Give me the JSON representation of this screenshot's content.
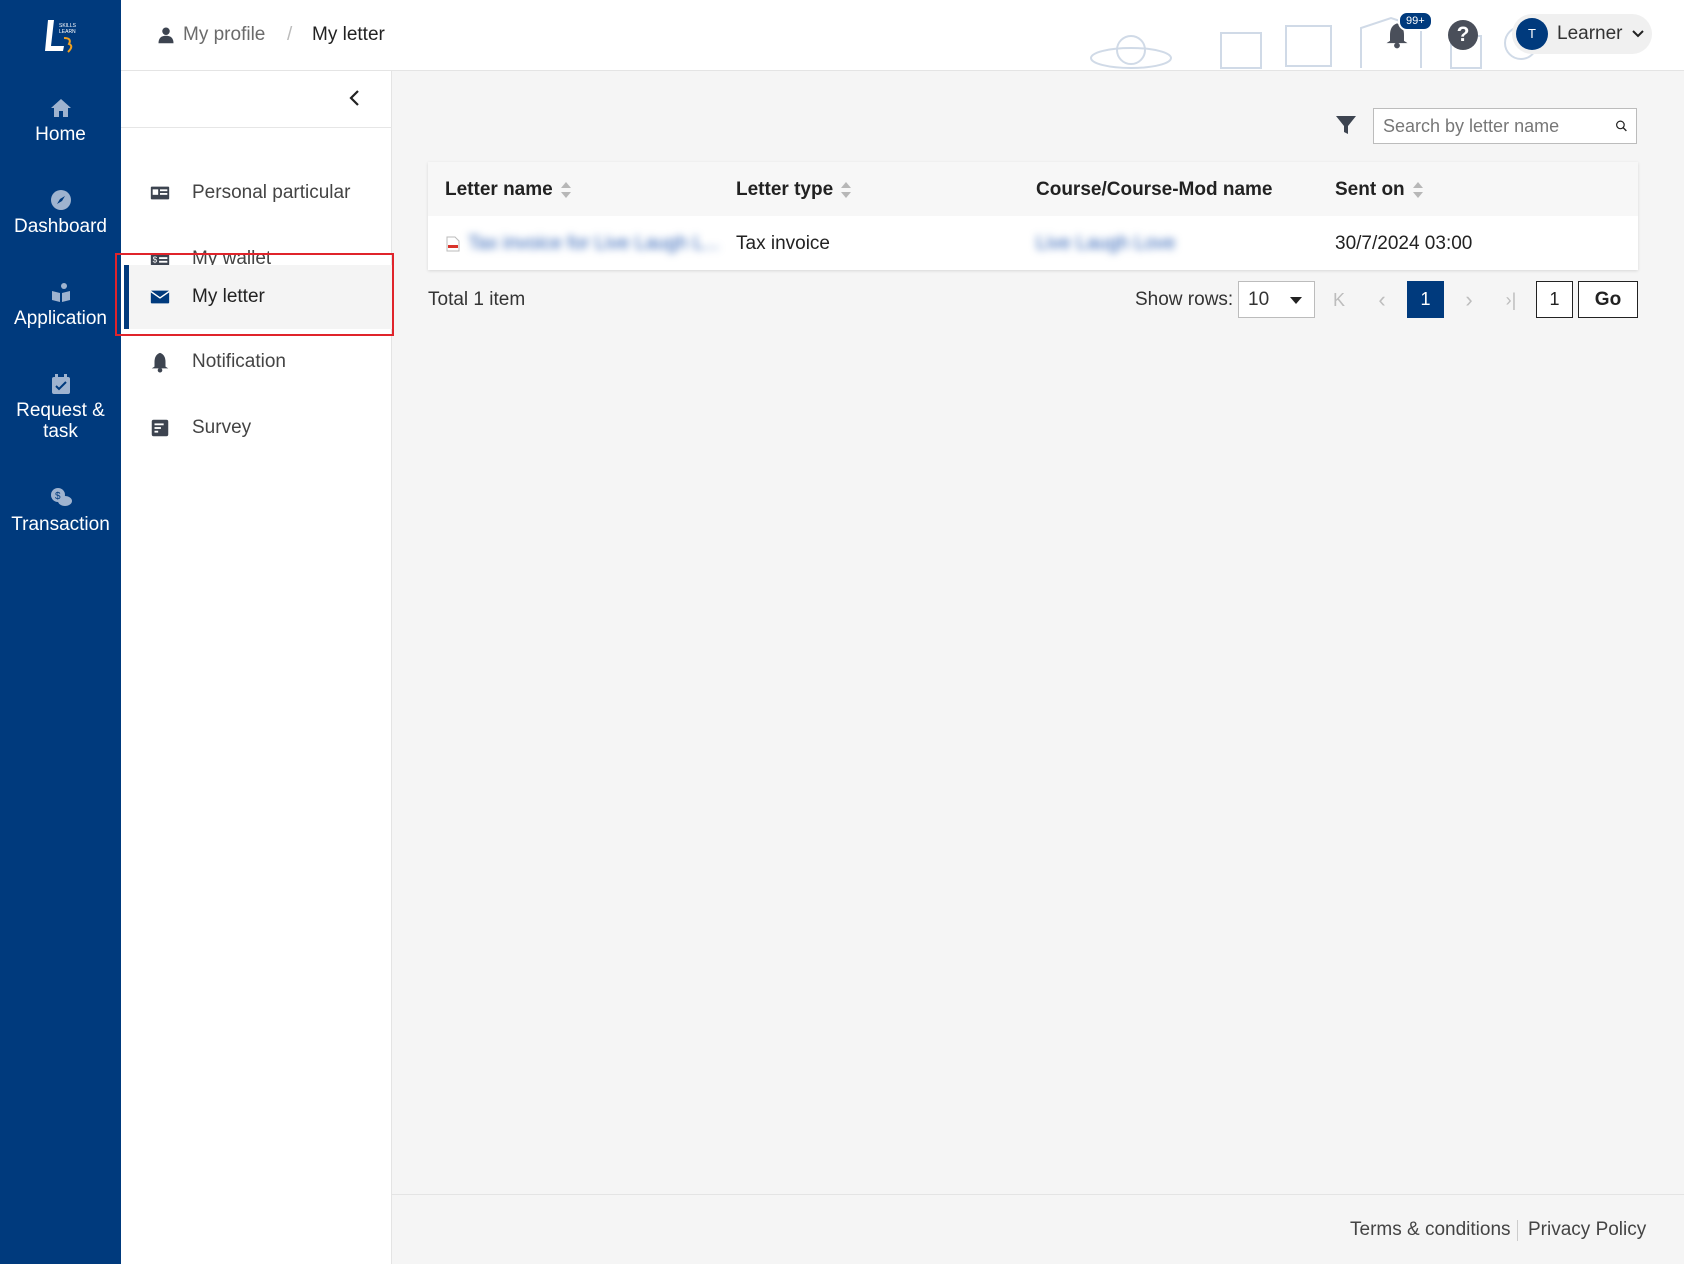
{
  "nav": {
    "items": [
      {
        "label": "Home",
        "icon": "home-icon"
      },
      {
        "label": "Dashboard",
        "icon": "compass-icon"
      },
      {
        "label": "Application",
        "icon": "application-icon"
      },
      {
        "label": "Request &",
        "label2": "task",
        "icon": "calendar-check-icon"
      },
      {
        "label": "Transaction",
        "icon": "transaction-icon"
      }
    ]
  },
  "header": {
    "breadcrumb": {
      "parent": "My profile",
      "separator": "/",
      "current": "My letter"
    },
    "notification_badge": "99+",
    "help_label": "?",
    "user": {
      "initial": "T",
      "name": "Learner"
    }
  },
  "sidebar": {
    "items": [
      {
        "label": "Personal particular",
        "icon": "id-card-icon"
      },
      {
        "label": "My wallet",
        "icon": "wallet-icon"
      },
      {
        "label": "My letter",
        "icon": "envelope-icon",
        "active": true
      },
      {
        "label": "Notification",
        "icon": "bell-icon"
      },
      {
        "label": "Survey",
        "icon": "survey-icon"
      }
    ]
  },
  "main": {
    "search_placeholder": "Search by letter name",
    "table": {
      "headers": [
        "Letter name",
        "Letter type",
        "Course/Course-Mod name",
        "Sent on"
      ],
      "rows": [
        {
          "letter_name": "Tax invoice for Live Laugh L...",
          "letter_type": "Tax invoice",
          "course": "Live Laugh Love",
          "sent_on": "30/7/2024 03:00"
        }
      ]
    },
    "total": "Total 1 item",
    "show_rows_label": "Show rows:",
    "rows_per_page": "10",
    "pagination": {
      "first": "K",
      "prev": "‹",
      "current": "1",
      "next": "›",
      "last": "›|",
      "goto_value": "1",
      "go_label": "Go"
    }
  },
  "footer": {
    "terms": "Terms & conditions",
    "privacy": "Privacy Policy"
  },
  "colors": {
    "brand": "#003a7d",
    "highlight": "#e0242b"
  }
}
